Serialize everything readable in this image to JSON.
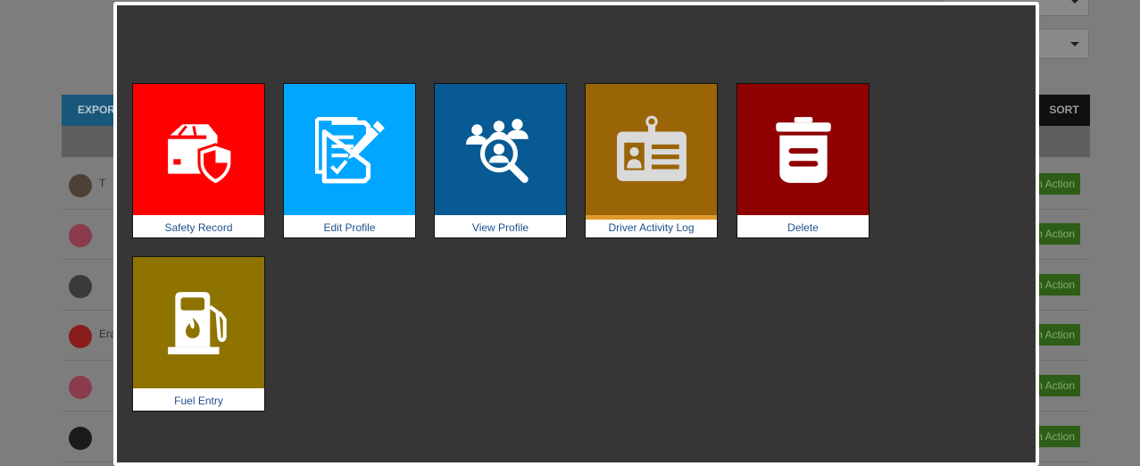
{
  "background": {
    "toolbar": {
      "export_label": "EXPOR",
      "sort_label": "SORT"
    },
    "rows": [
      {
        "name": "T",
        "action": "n Action",
        "avatar_color": "#4d4034"
      },
      {
        "name": "",
        "action": "n Action",
        "avatar_color": "#8a3b4d"
      },
      {
        "name": "",
        "action": "n Action",
        "avatar_color": "#3a3a3a"
      },
      {
        "name": "Era",
        "action": "n Action",
        "avatar_color": "#8a1c1c"
      },
      {
        "name": "",
        "action": "n Action",
        "avatar_color": "#8a3b4d"
      },
      {
        "name": "",
        "action": "n Action",
        "avatar_color": "#1a1a1a"
      }
    ]
  },
  "modal": {
    "tiles": [
      {
        "label": "Safety Record",
        "color": "#ff0000",
        "icon": "truck-shield-icon"
      },
      {
        "label": "Edit Profile",
        "color": "#00a6ff",
        "icon": "edit-document-icon"
      },
      {
        "label": "View Profile",
        "color": "#075a94",
        "icon": "people-search-icon"
      },
      {
        "label": "Driver Activity Log",
        "color": "#9a6507",
        "icon": "id-badge-icon",
        "accent_color": "#e09a2c"
      },
      {
        "label": "Delete",
        "color": "#8f0000",
        "icon": "trash-icon"
      },
      {
        "label": "Fuel Entry",
        "color": "#8f7300",
        "icon": "fuel-pump-icon"
      }
    ]
  }
}
